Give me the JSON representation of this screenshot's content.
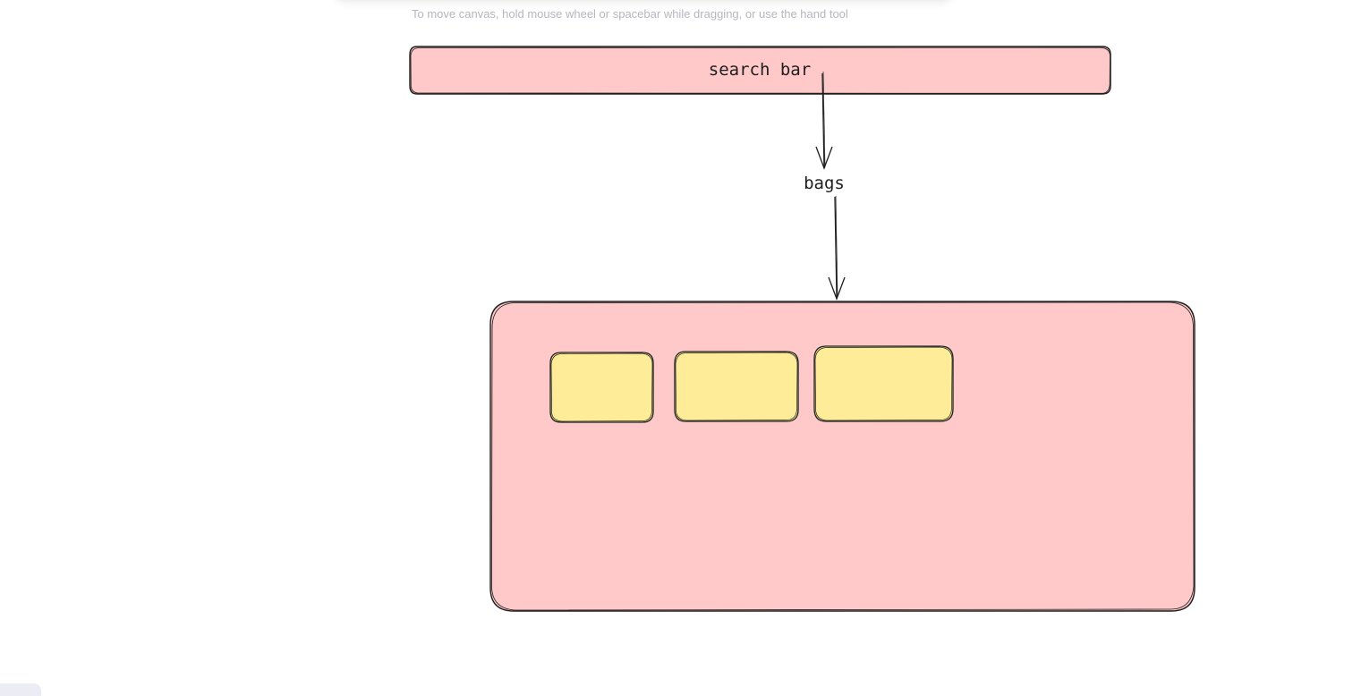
{
  "canvas_hint": "To move canvas, hold mouse wheel or spacebar while dragging, or use the hand tool",
  "diagram": {
    "search_bar_label": "search bar",
    "arrow_label": "bags"
  },
  "colors": {
    "pink_fill": "#ffc9c9",
    "yellow_fill": "#ffec99",
    "stroke": "#1e1e1e",
    "hint_text": "#b6b6be"
  }
}
